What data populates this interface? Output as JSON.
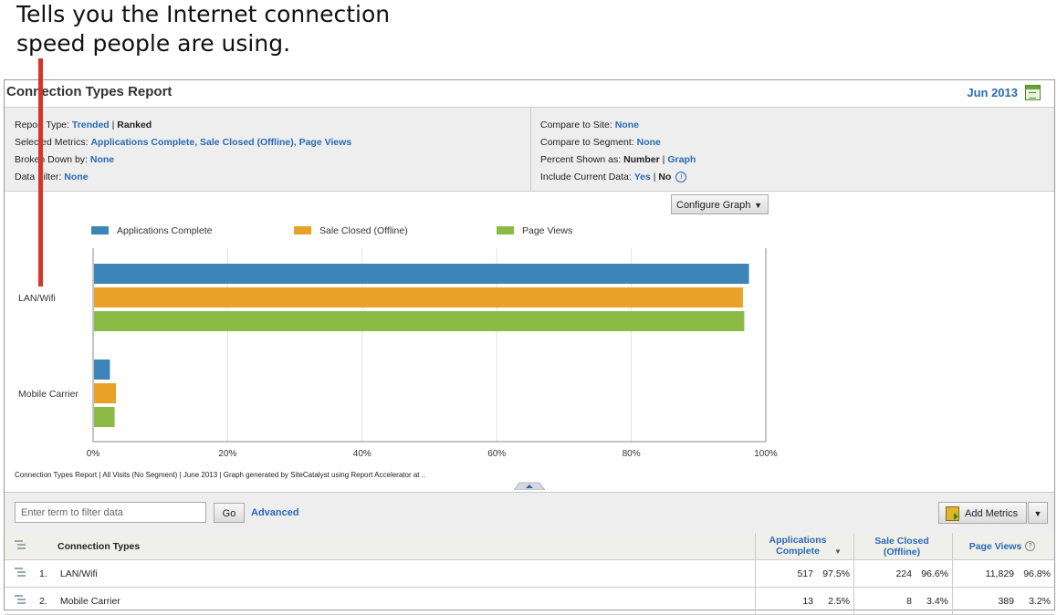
{
  "callout": {
    "line1": "Tells you the Internet connection",
    "line2": "speed people are using."
  },
  "header": {
    "title": "Connection Types Report",
    "date": "Jun 2013"
  },
  "settings": {
    "report_type_label": "Report Type:",
    "report_type_trended": "Trended",
    "report_type_ranked": "Ranked",
    "metrics_label": "Selected Metrics:",
    "metrics_value": "Applications Complete, Sale Closed (Offline), Page Views",
    "broken_label": "Broken Down by:",
    "broken_value": "None",
    "filter_label": "Data Filter:",
    "filter_value": "None",
    "compare_site_label": "Compare to Site:",
    "compare_site_value": "None",
    "compare_segment_label": "Compare to Segment:",
    "compare_segment_value": "None",
    "percent_label": "Percent Shown as:",
    "percent_number": "Number",
    "percent_graph": "Graph",
    "include_label": "Include Current Data:",
    "include_yes": "Yes",
    "include_no": "No",
    "sep": "|",
    "info_glyph": "i"
  },
  "configure_graph": {
    "label": "Configure Graph",
    "arrow": "▼"
  },
  "chart_data": {
    "type": "bar",
    "orientation": "horizontal",
    "categories": [
      "LAN/Wifi",
      "Mobile Carrier"
    ],
    "series": [
      {
        "name": "Applications Complete",
        "values": [
          97.5,
          2.5
        ],
        "color": "#3d84b8"
      },
      {
        "name": "Sale Closed (Offline)",
        "values": [
          96.6,
          3.4
        ],
        "color": "#e8a228"
      },
      {
        "name": "Page Views",
        "values": [
          96.8,
          3.2
        ],
        "color": "#8cbb45"
      }
    ],
    "xlim": [
      0,
      100
    ],
    "xticks": [
      "0%",
      "20%",
      "40%",
      "60%",
      "80%",
      "100%"
    ],
    "grid": true,
    "legend": "top"
  },
  "caption": "Connection Types Report | All Visits (No Segment) | June 2013 | Graph generated by SiteCatalyst using Report Accelerator at ..",
  "filter": {
    "placeholder": "Enter term to filter data",
    "go": "Go",
    "advanced": "Advanced",
    "add_metrics": "Add Metrics",
    "drop_arrow": "▼"
  },
  "table": {
    "headers": {
      "name": "Connection Types",
      "m1": "Applications Complete",
      "m2": "Sale Closed (Offline)",
      "m3": "Page Views",
      "sort_arrow": "▼",
      "help": "?"
    },
    "rows": [
      {
        "rank": "1.",
        "name": "LAN/Wifi",
        "m1": "517",
        "m1p": "97.5%",
        "m2": "224",
        "m2p": "96.6%",
        "m3": "11,829",
        "m3p": "96.8%"
      },
      {
        "rank": "2.",
        "name": "Mobile Carrier",
        "m1": "13",
        "m1p": "2.5%",
        "m2": "8",
        "m2p": "3.4%",
        "m3": "389",
        "m3p": "3.2%"
      }
    ]
  }
}
